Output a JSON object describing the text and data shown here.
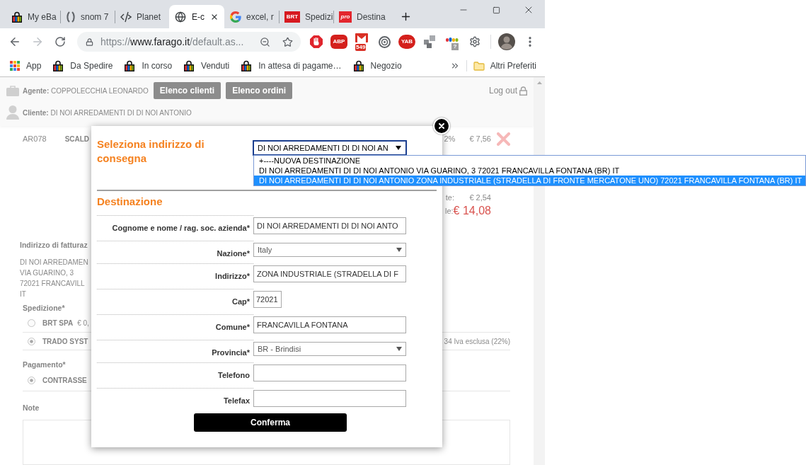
{
  "browser": {
    "tabs": [
      {
        "kind": "bag",
        "title": "My eBa",
        "selected": false
      },
      {
        "kind": "brackets",
        "title": "snom 7",
        "selected": false
      },
      {
        "kind": "code",
        "title": "Planet",
        "selected": false
      },
      {
        "kind": "globe",
        "title": "E-c",
        "selected": true
      },
      {
        "kind": "google",
        "title": "excel, r",
        "selected": false
      },
      {
        "kind": "brt",
        "logo_text": "BRT",
        "title": "Spedizi",
        "selected": false
      },
      {
        "kind": "pro",
        "logo_text": "pro",
        "title": "Destina",
        "selected": false
      }
    ],
    "address": {
      "scheme": "https://",
      "host": "www.farago.it",
      "path": "/default.as..."
    },
    "extensions": [
      {
        "kind": "stop"
      },
      {
        "kind": "abp",
        "text": "ABP"
      },
      {
        "kind": "mail",
        "badge": "549"
      },
      {
        "kind": "target"
      },
      {
        "kind": "yab",
        "text": "YAB"
      },
      {
        "kind": "blocks"
      },
      {
        "kind": "ebay",
        "badge": "?"
      },
      {
        "kind": "gear"
      }
    ],
    "bookmarks": [
      {
        "kind": "apps",
        "label": "App"
      },
      {
        "kind": "bag",
        "label": "Da Spedire"
      },
      {
        "kind": "bag",
        "label": "In corso"
      },
      {
        "kind": "bag",
        "label": "Venduti"
      },
      {
        "kind": "bag",
        "label": "In attesa di pagame…"
      },
      {
        "kind": "bag",
        "label": "Negozio"
      }
    ],
    "other_bookmarks": "Altri Preferiti"
  },
  "page": {
    "agent": "**Agente:** COPPOLECCHIA LEONARDO",
    "header_buttons": [
      "Elenco clienti",
      "Elenco ordini"
    ],
    "logout": "Log out",
    "client": "**Cliente:** DI NOI ARREDAMENTI DI DI NOI ANTONIO",
    "item": {
      "code": "AR078",
      "name": "SCALD",
      "discount": "2%",
      "price": "€ 7,56"
    },
    "totals": [
      {
        "kind": "subtotal",
        "label": "te:",
        "value": "€ 2,54"
      },
      {
        "kind": "total",
        "label": "le:",
        "value": "€ 14,08"
      }
    ],
    "billing": {
      "title": "Indirizzo di fatturaz",
      "lines": [
        "DI NOI ARREDAMEN",
        "VIA GUARINO, 3",
        "72021 FRANCAVILL",
        "IT"
      ]
    },
    "shipping": {
      "title": "Spedizione*",
      "options": [
        {
          "name": "BRT SPA",
          "price": "€ 0,",
          "selected": false
        },
        {
          "name": "TRADO SYST",
          "note": "34 Iva esclusa (22%)",
          "selected": true
        }
      ]
    },
    "payment": {
      "title": "Pagamento*",
      "options": [
        {
          "name": "CONTRASSE",
          "selected": true
        }
      ]
    },
    "note": {
      "label": "Note"
    }
  },
  "modal": {
    "title": "Seleziona indirizzo di consegna",
    "address_select": {
      "value": "DI NOI ARREDAMENTI DI DI NOI AN",
      "expanded": true,
      "options": [
        {
          "label": "+----NUOVA DESTINAZIONE",
          "selected": false
        },
        {
          "label": "DI NOI ARREDAMENTI DI DI NOI ANTONIO VIA GUARINO, 3 72021 FRANCAVILLA FONTANA (BR) IT",
          "selected": false
        },
        {
          "label": "DI NOI ARREDAMENTI DI DI NOI ANTONIO ZONA INDUSTRIALE (STRADELLA DI FRONTE MERCATONE UNO) 72021 FRANCAVILLA FONTANA (BR) IT",
          "selected": true
        }
      ]
    },
    "section": "Destinazione",
    "fields": [
      {
        "label": "Cognome e nome / rag. soc. azienda*",
        "kind": "text",
        "value": "DI NOI ARREDAMENTI DI DI NOI ANTO"
      },
      {
        "label": "Nazione*",
        "kind": "select",
        "value": "Italy"
      },
      {
        "label": "Indirizzo*",
        "kind": "text",
        "value": "ZONA INDUSTRIALE (STRADELLA DI F"
      },
      {
        "label": "Cap*",
        "kind": "short",
        "value": "72021"
      },
      {
        "label": "Comune*",
        "kind": "text",
        "value": "FRANCAVILLA FONTANA"
      },
      {
        "label": "Provincia*",
        "kind": "select",
        "value": "BR - Brindisi"
      },
      {
        "label": "Telefono",
        "kind": "text"
      },
      {
        "label": "Telefax",
        "kind": "text"
      }
    ],
    "confirm": "Conferma"
  }
}
